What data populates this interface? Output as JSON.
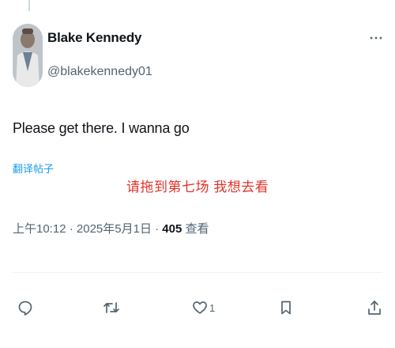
{
  "tweet": {
    "author": {
      "display_name": "Blake Kennedy",
      "handle": "@blakekennedy01"
    },
    "text": "Please get there. I wanna go",
    "translate_label": "翻译帖子",
    "overlay_text": "请拖到第七场 我想去看",
    "meta": {
      "time": "上午10:12",
      "separator1": " · ",
      "date": "2025年5月1日",
      "separator2": " · ",
      "views_count": "405",
      "views_label": " 查看"
    },
    "actions": {
      "like_count": "1"
    }
  },
  "icons": {
    "more": "more-horizontal-icon",
    "reply": "reply-icon",
    "retweet": "retweet-icon",
    "like": "heart-icon",
    "bookmark": "bookmark-icon",
    "share": "share-icon"
  },
  "colors": {
    "text_primary": "#0f1419",
    "text_secondary": "#536471",
    "link": "#1d9bf0",
    "overlay_red": "#e0332b",
    "divider": "#eff3f4"
  }
}
